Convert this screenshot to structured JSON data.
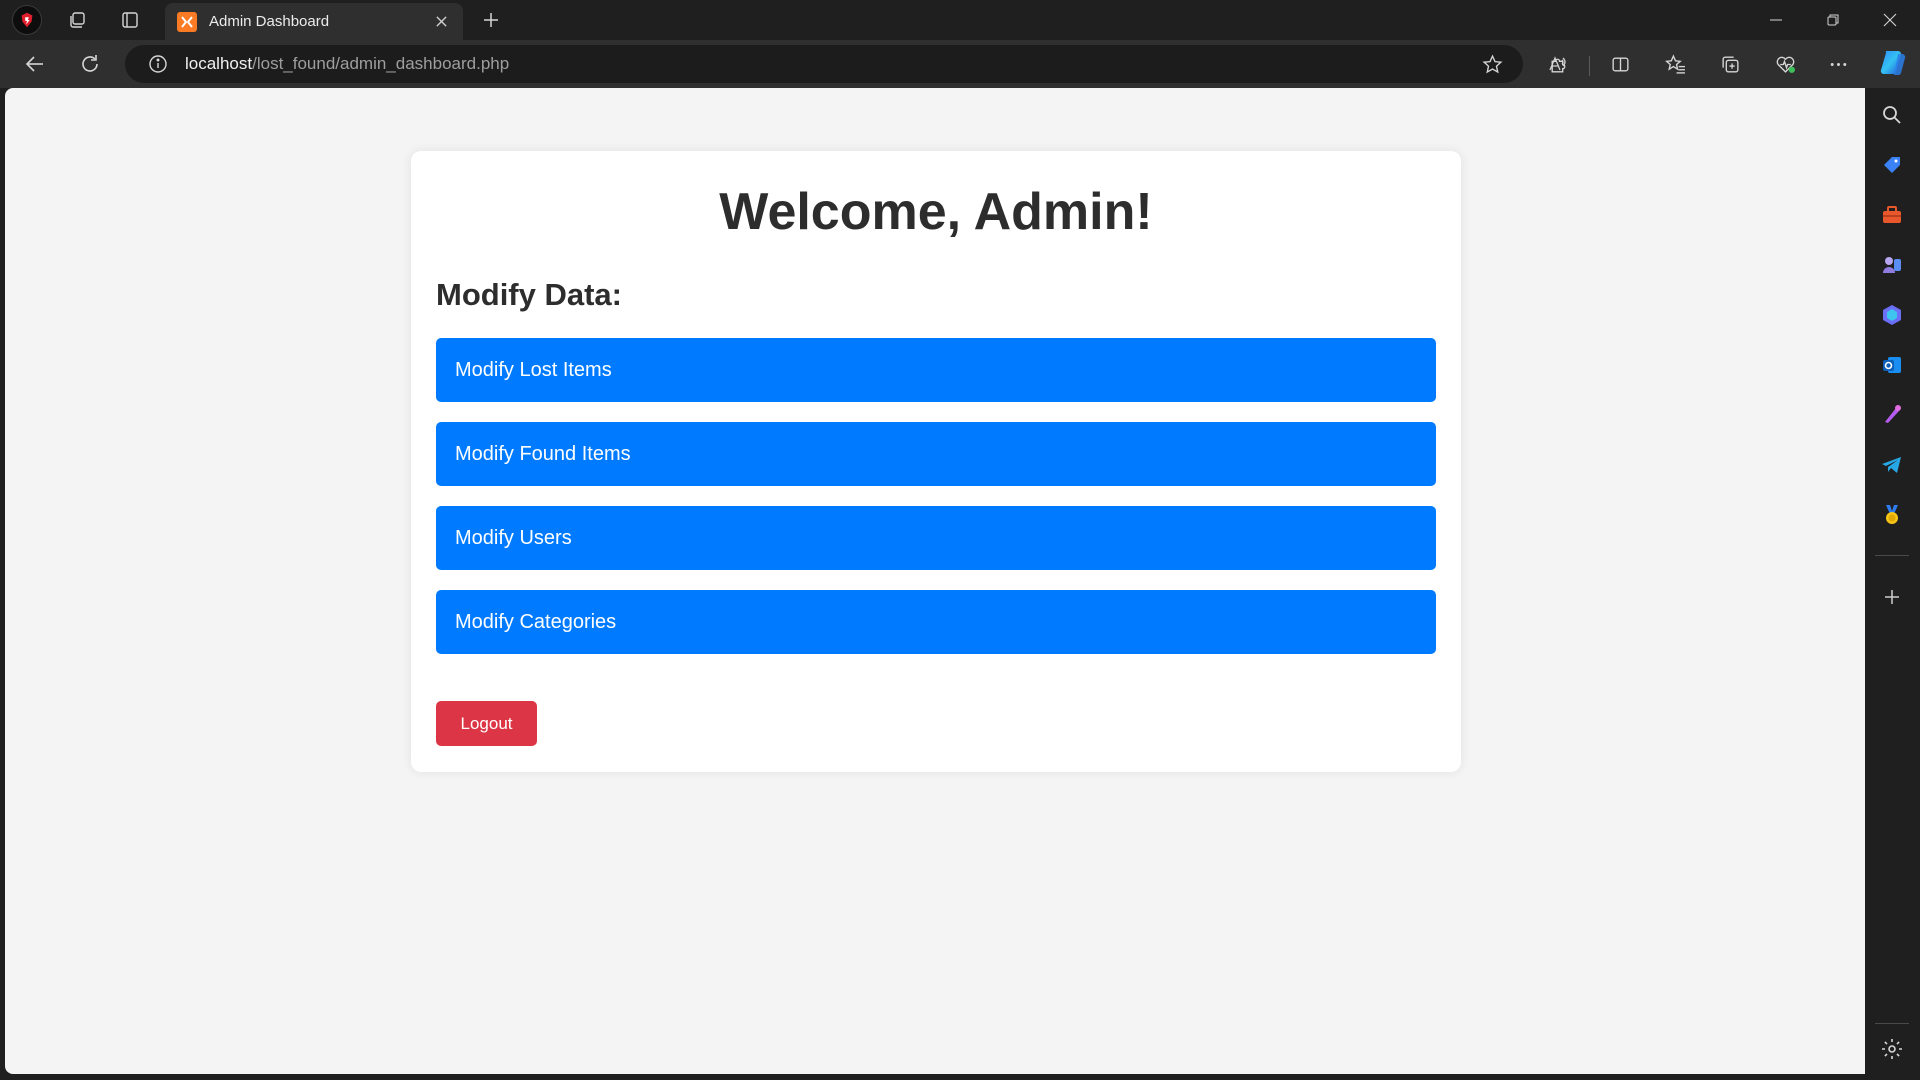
{
  "browser": {
    "tab": {
      "title": "Admin Dashboard"
    },
    "address": {
      "host": "localhost",
      "path": "/lost_found/admin_dashboard.php"
    }
  },
  "page": {
    "welcome": "Welcome, Admin!",
    "section_heading": "Modify Data:",
    "buttons": [
      {
        "label": "Modify Lost Items"
      },
      {
        "label": "Modify Found Items"
      },
      {
        "label": "Modify Users"
      },
      {
        "label": "Modify Categories"
      }
    ],
    "logout_label": "Logout",
    "colors": {
      "primary": "#007bff",
      "danger": "#dc3545",
      "background": "#f4f4f4"
    }
  }
}
